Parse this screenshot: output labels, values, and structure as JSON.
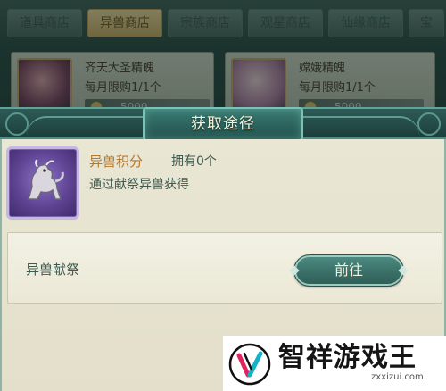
{
  "shop": {
    "tabs": [
      {
        "label": "道具商店",
        "active": false
      },
      {
        "label": "异兽商店",
        "active": true
      },
      {
        "label": "宗族商店",
        "active": false
      },
      {
        "label": "观星商店",
        "active": false
      },
      {
        "label": "仙缘商店",
        "active": false
      },
      {
        "label": "宝",
        "active": false
      }
    ],
    "cards": [
      {
        "name": "齐天大圣精魄",
        "limit": "每月限购1/1个",
        "price": "5000"
      },
      {
        "name": "嫦娥精魄",
        "limit": "每月限购1/1个",
        "price": "5000"
      }
    ]
  },
  "popup": {
    "title": "获取途径",
    "item": {
      "name": "异兽积分",
      "owned": "拥有0个",
      "description": "通过献祭异兽获得"
    },
    "source": {
      "label": "异兽献祭",
      "button": "前往"
    }
  },
  "watermark": {
    "text": "智祥游戏王",
    "sub": "zxxizui.com"
  },
  "colors": {
    "header_teal": "#2d5a55",
    "body_cream": "#e9e6d4",
    "item_name_gold": "#b5782c",
    "text_green": "#3f5a4f",
    "button_teal": "#3a7068",
    "icon_purple": "#5e4392"
  }
}
